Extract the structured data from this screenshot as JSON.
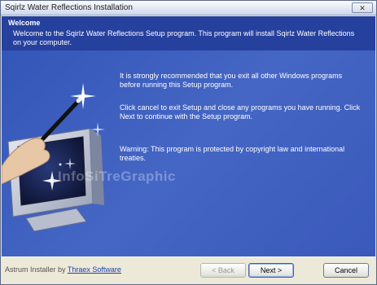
{
  "window": {
    "title": "Sqirlz Water Reflections Installation",
    "close_glyph": "✕"
  },
  "header": {
    "title": "Welcome",
    "description": "Welcome to the Sqirlz Water Reflections Setup program. This program will install Sqirlz Water Reflections on your computer."
  },
  "main": {
    "messages": [
      "It is strongly recommended that you exit all other Windows programs before running this Setup program.",
      "Click cancel to exit Setup and close any programs you have running. Click Next to continue with the Setup program.",
      "Warning: This program is protected by copyright law and international treaties."
    ],
    "watermark": "InfoSiTreGraphic",
    "icons": [
      "magic-wand-icon",
      "monitor-icon",
      "hand-icon",
      "sparkle-icon"
    ]
  },
  "footer": {
    "credit_prefix": "Astrum Installer by",
    "credit_link": "Thraex Software",
    "buttons": {
      "back": "< Back",
      "next": "Next >",
      "cancel": "Cancel"
    }
  },
  "colors": {
    "header_bg": "#26409e",
    "main_bg": "#3f5fbf",
    "footer_bg": "#ece9d8",
    "link": "#1a3fb0"
  }
}
